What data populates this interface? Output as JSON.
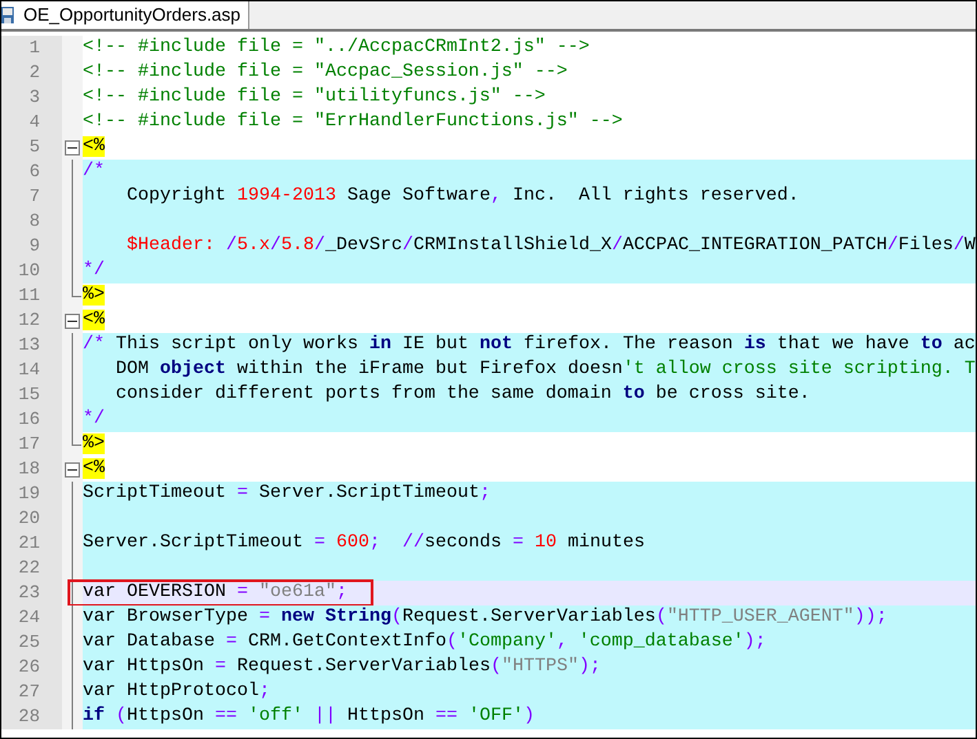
{
  "tabs": [
    {
      "label": "OE_OpportunityOrders.asp",
      "selected": true
    }
  ],
  "lines": [
    {
      "number": "1",
      "kind": "plain",
      "script": false,
      "current": false,
      "highlighted": false,
      "tokens": [
        {
          "kind": "html-comment",
          "text": "<!-- #include file = \"../AccpacCRmInt2.js\" -->"
        }
      ]
    },
    {
      "number": "2",
      "kind": "plain",
      "script": false,
      "current": false,
      "highlighted": false,
      "tokens": [
        {
          "kind": "html-comment",
          "text": "<!-- #include file = \"Accpac_Session.js\" -->"
        }
      ]
    },
    {
      "number": "3",
      "kind": "plain",
      "script": false,
      "current": false,
      "highlighted": false,
      "tokens": [
        {
          "kind": "html-comment",
          "text": "<!-- #include file = \"utilityfuncs.js\" -->"
        }
      ]
    },
    {
      "number": "4",
      "kind": "plain",
      "script": false,
      "current": false,
      "highlighted": false,
      "tokens": [
        {
          "kind": "html-comment",
          "text": "<!-- #include file = \"ErrHandlerFunctions.js\" -->"
        }
      ]
    },
    {
      "number": "5",
      "kind": "fold-start",
      "script": false,
      "current": false,
      "highlighted": false,
      "tokens": [
        {
          "kind": "delimiter",
          "text": "<%"
        }
      ]
    },
    {
      "number": "6",
      "kind": "fold-body",
      "script": true,
      "current": false,
      "highlighted": false,
      "tokens": [
        {
          "kind": "comment",
          "text": "/*"
        }
      ]
    },
    {
      "number": "7",
      "kind": "fold-body",
      "script": true,
      "current": false,
      "highlighted": false,
      "tokens": [
        {
          "kind": "text",
          "text": "    Copyright "
        },
        {
          "kind": "number",
          "text": "1994-2013"
        },
        {
          "kind": "text",
          "text": " Sage Software"
        },
        {
          "kind": "operator",
          "text": ","
        },
        {
          "kind": "text",
          "text": " Inc.  All rights reserved."
        }
      ]
    },
    {
      "number": "8",
      "kind": "fold-body",
      "script": true,
      "current": false,
      "highlighted": false
    },
    {
      "number": "9",
      "kind": "fold-body",
      "script": true,
      "current": false,
      "highlighted": false,
      "tokens": [
        {
          "kind": "number",
          "text": "    $Header:"
        },
        {
          "kind": "operator",
          "text": " /"
        },
        {
          "kind": "number",
          "text": "5.x"
        },
        {
          "kind": "operator",
          "text": "/"
        },
        {
          "kind": "number",
          "text": "5.8"
        },
        {
          "kind": "operator",
          "text": "/"
        },
        {
          "kind": "text",
          "text": "_DevSrc"
        },
        {
          "kind": "operator",
          "text": "/"
        },
        {
          "kind": "text",
          "text": "CRMInstallShield_X"
        },
        {
          "kind": "operator",
          "text": "/"
        },
        {
          "kind": "text",
          "text": "ACCPAC_INTEGRATION_PATCH"
        },
        {
          "kind": "operator",
          "text": "/"
        },
        {
          "kind": "text",
          "text": "Files"
        },
        {
          "kind": "operator",
          "text": "/"
        },
        {
          "kind": "text",
          "text": "W"
        }
      ]
    },
    {
      "number": "10",
      "kind": "fold-body",
      "script": true,
      "current": false,
      "highlighted": false,
      "tokens": [
        {
          "kind": "comment",
          "text": "*/"
        }
      ]
    },
    {
      "number": "11",
      "kind": "fold-end",
      "script": false,
      "current": false,
      "highlighted": false,
      "tokens": [
        {
          "kind": "delimiter",
          "text": "%>"
        }
      ]
    },
    {
      "number": "12",
      "kind": "fold-start",
      "script": false,
      "current": false,
      "highlighted": false,
      "tokens": [
        {
          "kind": "delimiter",
          "text": "<%"
        }
      ]
    },
    {
      "number": "13",
      "kind": "fold-body",
      "script": true,
      "current": false,
      "highlighted": false,
      "tokens": [
        {
          "kind": "comment",
          "text": "/*"
        },
        {
          "kind": "text",
          "text": " This script only works "
        },
        {
          "kind": "keyword",
          "text": "in"
        },
        {
          "kind": "text",
          "text": " IE but "
        },
        {
          "kind": "keyword",
          "text": "not"
        },
        {
          "kind": "text",
          "text": " firefox. The reason "
        },
        {
          "kind": "keyword",
          "text": "is"
        },
        {
          "kind": "text",
          "text": " that we have "
        },
        {
          "kind": "keyword",
          "text": "to"
        },
        {
          "kind": "text",
          "text": " ac"
        }
      ]
    },
    {
      "number": "14",
      "kind": "fold-body",
      "script": true,
      "current": false,
      "highlighted": false,
      "tokens": [
        {
          "kind": "text",
          "text": "   DOM "
        },
        {
          "kind": "keyword",
          "text": "object"
        },
        {
          "kind": "text",
          "text": " within the iFrame but Firefox doesn"
        },
        {
          "kind": "char-string",
          "text": "'t allow cross site scripting. T"
        }
      ]
    },
    {
      "number": "15",
      "kind": "fold-body",
      "script": true,
      "current": false,
      "highlighted": false,
      "tokens": [
        {
          "kind": "text",
          "text": "   consider different ports from the same domain "
        },
        {
          "kind": "keyword",
          "text": "to"
        },
        {
          "kind": "text",
          "text": " be cross site."
        }
      ]
    },
    {
      "number": "16",
      "kind": "fold-body",
      "script": true,
      "current": false,
      "highlighted": false,
      "tokens": [
        {
          "kind": "comment",
          "text": "*/"
        }
      ]
    },
    {
      "number": "17",
      "kind": "fold-end",
      "script": false,
      "current": false,
      "highlighted": false,
      "tokens": [
        {
          "kind": "delimiter",
          "text": "%>"
        }
      ]
    },
    {
      "number": "18",
      "kind": "fold-start",
      "script": false,
      "current": false,
      "highlighted": false,
      "tokens": [
        {
          "kind": "delimiter",
          "text": "<%"
        }
      ]
    },
    {
      "number": "19",
      "kind": "fold-body",
      "script": true,
      "current": false,
      "highlighted": false,
      "tokens": [
        {
          "kind": "text",
          "text": "ScriptTimeout "
        },
        {
          "kind": "operator",
          "text": "="
        },
        {
          "kind": "text",
          "text": " Server.ScriptTimeout"
        },
        {
          "kind": "operator",
          "text": ";"
        }
      ]
    },
    {
      "number": "20",
      "kind": "fold-body",
      "script": true,
      "current": false,
      "highlighted": false
    },
    {
      "number": "21",
      "kind": "fold-body",
      "script": true,
      "current": false,
      "highlighted": false,
      "tokens": [
        {
          "kind": "text",
          "text": "Server.ScriptTimeout "
        },
        {
          "kind": "operator",
          "text": "="
        },
        {
          "kind": "number",
          "text": " 600"
        },
        {
          "kind": "operator",
          "text": ";  //"
        },
        {
          "kind": "text",
          "text": "seconds "
        },
        {
          "kind": "operator",
          "text": "="
        },
        {
          "kind": "number",
          "text": " 10"
        },
        {
          "kind": "text",
          "text": " minutes"
        }
      ]
    },
    {
      "number": "22",
      "kind": "fold-body",
      "script": true,
      "current": false,
      "highlighted": false
    },
    {
      "number": "23",
      "kind": "fold-body",
      "current": true,
      "highlighted": true,
      "tokens": [
        {
          "kind": "text",
          "text": "var OEVERSION "
        },
        {
          "kind": "operator",
          "text": "="
        },
        {
          "kind": "string",
          "text": " \"oe61a\""
        },
        {
          "kind": "operator",
          "text": ";"
        }
      ]
    },
    {
      "number": "24",
      "kind": "fold-body",
      "script": true,
      "current": false,
      "highlighted": false,
      "tokens": [
        {
          "kind": "text",
          "text": "var BrowserType "
        },
        {
          "kind": "operator",
          "text": "="
        },
        {
          "kind": "keyword",
          "text": " new String"
        },
        {
          "kind": "operator",
          "text": "("
        },
        {
          "kind": "text",
          "text": "Request.ServerVariables"
        },
        {
          "kind": "operator",
          "text": "("
        },
        {
          "kind": "string",
          "text": "\"HTTP_USER_AGENT\""
        },
        {
          "kind": "operator",
          "text": "));"
        }
      ]
    },
    {
      "number": "25",
      "kind": "fold-body",
      "script": true,
      "current": false,
      "highlighted": false,
      "tokens": [
        {
          "kind": "text",
          "text": "var Database "
        },
        {
          "kind": "operator",
          "text": "="
        },
        {
          "kind": "text",
          "text": " CRM.GetContextInfo"
        },
        {
          "kind": "operator",
          "text": "("
        },
        {
          "kind": "char-string",
          "text": "'Company'"
        },
        {
          "kind": "operator",
          "text": ","
        },
        {
          "kind": "char-string",
          "text": " 'comp_database'"
        },
        {
          "kind": "operator",
          "text": ");"
        }
      ]
    },
    {
      "number": "26",
      "kind": "fold-body",
      "script": true,
      "current": false,
      "highlighted": false,
      "tokens": [
        {
          "kind": "text",
          "text": "var HttpsOn "
        },
        {
          "kind": "operator",
          "text": "="
        },
        {
          "kind": "text",
          "text": " Request.ServerVariables"
        },
        {
          "kind": "operator",
          "text": "("
        },
        {
          "kind": "string",
          "text": "\"HTTPS\""
        },
        {
          "kind": "operator",
          "text": ");"
        }
      ]
    },
    {
      "number": "27",
      "kind": "fold-body",
      "script": true,
      "current": false,
      "highlighted": false,
      "tokens": [
        {
          "kind": "text",
          "text": "var HttpProtocol"
        },
        {
          "kind": "operator",
          "text": ";"
        }
      ]
    },
    {
      "number": "28",
      "kind": "fold-body",
      "script": true,
      "current": false,
      "highlighted": false,
      "tokens": [
        {
          "kind": "keyword",
          "text": "if"
        },
        {
          "kind": "operator",
          "text": " ("
        },
        {
          "kind": "text",
          "text": "HttpsOn "
        },
        {
          "kind": "operator",
          "text": "=="
        },
        {
          "kind": "char-string",
          "text": " 'off' "
        },
        {
          "kind": "operator",
          "text": "||"
        },
        {
          "kind": "text",
          "text": " HttpsOn "
        },
        {
          "kind": "operator",
          "text": "=="
        },
        {
          "kind": "char-string",
          "text": " 'OFF'"
        },
        {
          "kind": "operator",
          "text": ")"
        }
      ]
    }
  ]
}
